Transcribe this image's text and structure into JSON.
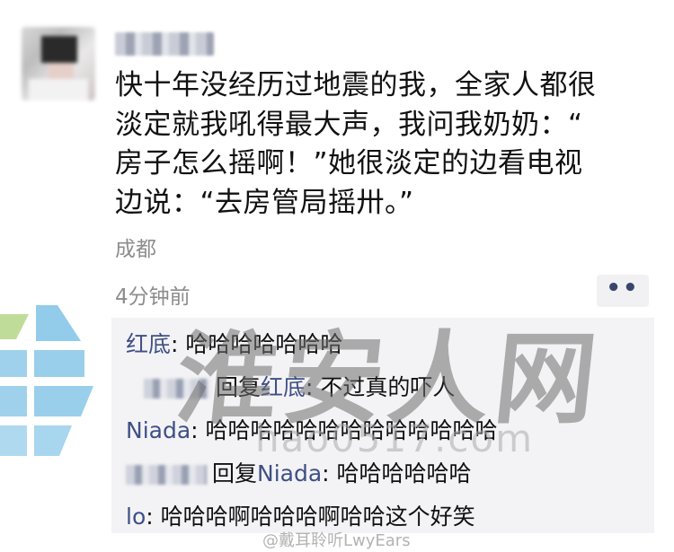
{
  "post": {
    "lines": [
      "快十年没经历过地震的我，全家人都很",
      "淡定就我吼得最大声，我问我奶奶：“",
      "房子怎么摇啊！”她很淡定的边看电视",
      "边说：“去房管局摇卅。”"
    ],
    "location": "成都",
    "time": "4分钟前",
    "more_label": "••"
  },
  "comments": [
    {
      "name": "红底",
      "sep": ": ",
      "text": "哈哈哈哈哈哈哈"
    },
    {
      "reply_word": "回复",
      "target": "红底",
      "sep": ": ",
      "text": "不过真的吓人"
    },
    {
      "name": "Niada",
      "sep": ": ",
      "text": "哈哈哈哈哈哈哈哈哈哈哈哈哈"
    },
    {
      "reply_word": "回复",
      "target": "Niada",
      "sep": ": ",
      "text": "哈哈哈哈哈哈"
    },
    {
      "name": "lo",
      "sep": ": ",
      "text": "哈哈哈啊哈哈哈啊哈哈这个好笑"
    }
  ],
  "watermark": {
    "text": "淮安人网",
    "url": "hao0517.com",
    "weibo": "@戴耳聆听LwyEars"
  },
  "colors": {
    "name_blue": "#3f4f86",
    "comment_bg": "#f3f3f5",
    "meta_gray": "#8d8d8d"
  }
}
